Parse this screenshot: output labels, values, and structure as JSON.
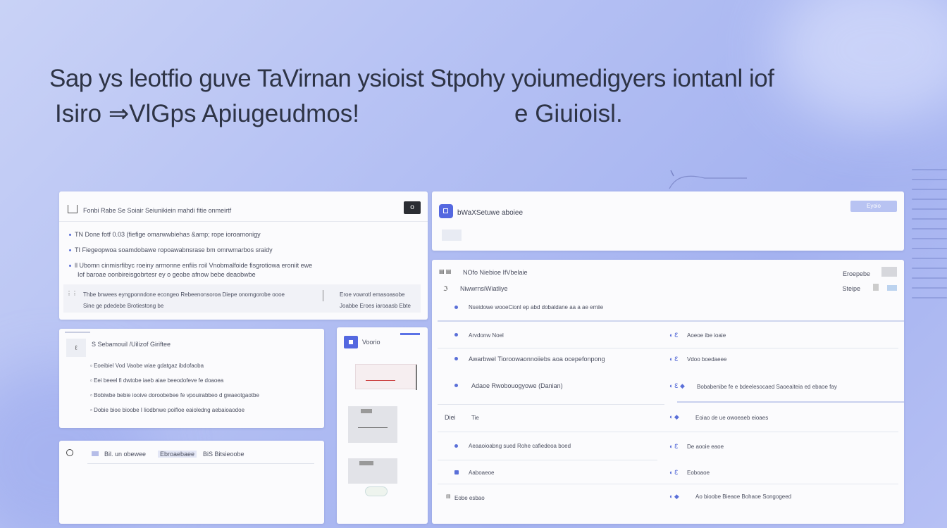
{
  "hero": {
    "line1": "Sap ys leotfio guve TaVirnan ysioist Stpohy yoiumedigyers iontanl iof",
    "line2a": "Isiro ⇒VlGps Apiugeudmos!",
    "line2b": "e Giuioisl."
  },
  "top_left_panel": {
    "header": "Fonbi Rabe Se Soiair Seiunikiein mahdi fitie onmeirtf",
    "close_label": "o",
    "items": [
      "TN Done fotf 0.03 (fiefige omarwwbiehas &amp; rope ioroamonigy",
      "TI Fiegeopwoa soamdobawe ropoawabnsrase bm omrwmarbos sraidy",
      "ll Ubomn cinmisrfibyc roeiny armonne enfiis roil Vnobmalfoide fisgrotiowa eroniit ewe",
      "Iof baroae oonbireisgobrtesr ey o geobe afnow bebe deaobwbe"
    ],
    "footer_left_a": "Thbe bnwees eyngponndone econgeo Rebeenonsoroa Diepe onorngorobe oooe",
    "footer_left_b": "Sine ge pdedebe Brotiestong be",
    "footer_right_a": "Eroe vowrotl emasoasobe",
    "footer_right_b": "Joabbe Eroes iaroaasb Ebte"
  },
  "mid_left_panel": {
    "title": "S Sebamouil /Uilizof Giriftee",
    "items": [
      "Eoeibiel Vod Vaobe wiae gdatgaz ibdofaoba",
      "Eei beeel fi dwtobe iaeb aiae beeodofeve fe doaoea",
      "Bobiwbe bebie iooive doroobebee fe vpouirabbeo d gwaeotgaotbe",
      "Dobie bioe bioobe I liodbnwe poifloe eaioledng aebaioaodoe"
    ]
  },
  "bottom_left_panel": {
    "tab1": "Bil. un obewee",
    "tab2": "Ebroaebaee",
    "tab3": "BiS Bitsieoobe"
  },
  "middle_column": {
    "title": "Voorio"
  },
  "right_top_panel": {
    "title": "bWaXSetuwe aboiee",
    "button_label": "Eyoio"
  },
  "right_main_panel": {
    "header_a": "NOfo Niebioe IfVbelaie",
    "header_b": "NiwwrnsiWiatliye",
    "header_right_a": "Eroepebe",
    "header_right_b": "Steipe",
    "subheader": "Nseidowe wooeCionl ep abd dobaldane aa a ae emiie",
    "rows": [
      {
        "left": "Arvdonw Noel",
        "right": "Aoeoe ibe ioaie"
      },
      {
        "left": "Awarbwel Tioroowaonnoiiebs aoa ocepefonpong",
        "right": "Vdoo boedaeee"
      },
      {
        "left": "Adaoe Rwobouogyowe (Danian)",
        "right": "Bobabenibe fe e bdeelesocaed Saoeaiteia ed ebaoe fay"
      },
      {
        "left": "Tie",
        "prefix": "Diei",
        "right": "Eoiao de ue owoeaeb eioaes"
      },
      {
        "left": "Aeaaoioabng sued Rohe cafiedeoa boed",
        "right": "De aooie eaoe"
      },
      {
        "left": "Aaboaeoe",
        "right": "Eoboaoe"
      },
      {
        "left": "Eobe esbao",
        "right": "Ao bioobe Bieaoe Bohaoe Songogeed"
      }
    ]
  },
  "colors": {
    "accent": "#5468e0",
    "bg_start": "#c9d2f6",
    "bg_end": "#a4b2f0",
    "panel": "#fbfbfd"
  }
}
